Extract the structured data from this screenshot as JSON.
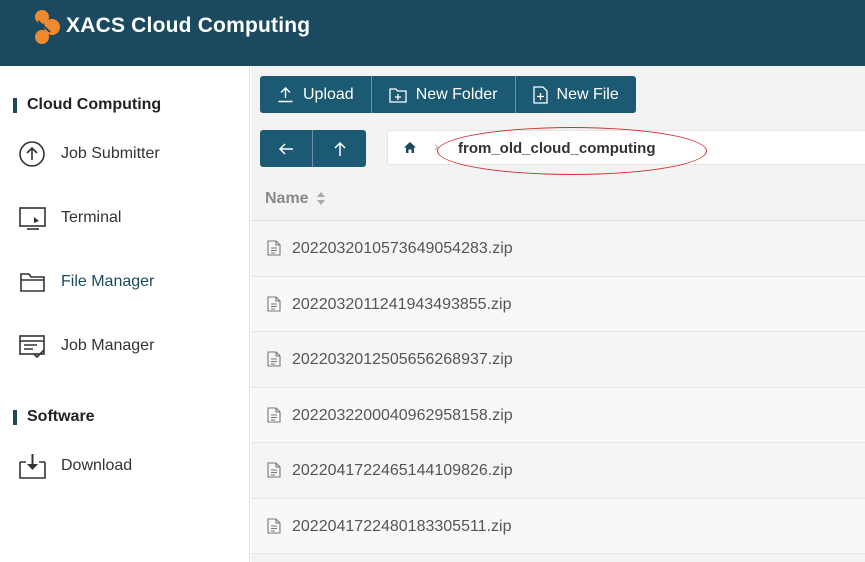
{
  "header": {
    "title": "XACS Cloud Computing",
    "accent": "#1b4a60",
    "logo_color": "#f08a2c"
  },
  "sidebar": {
    "sections": [
      {
        "title": "Cloud Computing"
      },
      {
        "title": "Software"
      }
    ],
    "items": [
      {
        "label": "Job Submitter",
        "icon": "upload-circle-icon"
      },
      {
        "label": "Terminal",
        "icon": "terminal-icon"
      },
      {
        "label": "File Manager",
        "icon": "folder-icon",
        "active": true
      },
      {
        "label": "Job Manager",
        "icon": "job-list-icon"
      },
      {
        "label": "Download",
        "icon": "download-icon"
      }
    ]
  },
  "toolbar": {
    "upload_label": "Upload",
    "new_folder_label": "New Folder",
    "new_file_label": "New File"
  },
  "breadcrumb": {
    "home_icon": "home-icon",
    "current": "from_old_cloud_computing",
    "highlight_color": "#d43030"
  },
  "table": {
    "columns": [
      "Name"
    ],
    "rows": [
      {
        "name": "20220320105736490542​83.zip"
      },
      {
        "name": "20220320112419434938​55.zip"
      },
      {
        "name": "20220320125056562689​37.zip"
      },
      {
        "name": "20220322000409629581​58.zip"
      },
      {
        "name": "20220417224651441098​26.zip"
      },
      {
        "name": "20220417224801833055​11.zip"
      }
    ]
  }
}
